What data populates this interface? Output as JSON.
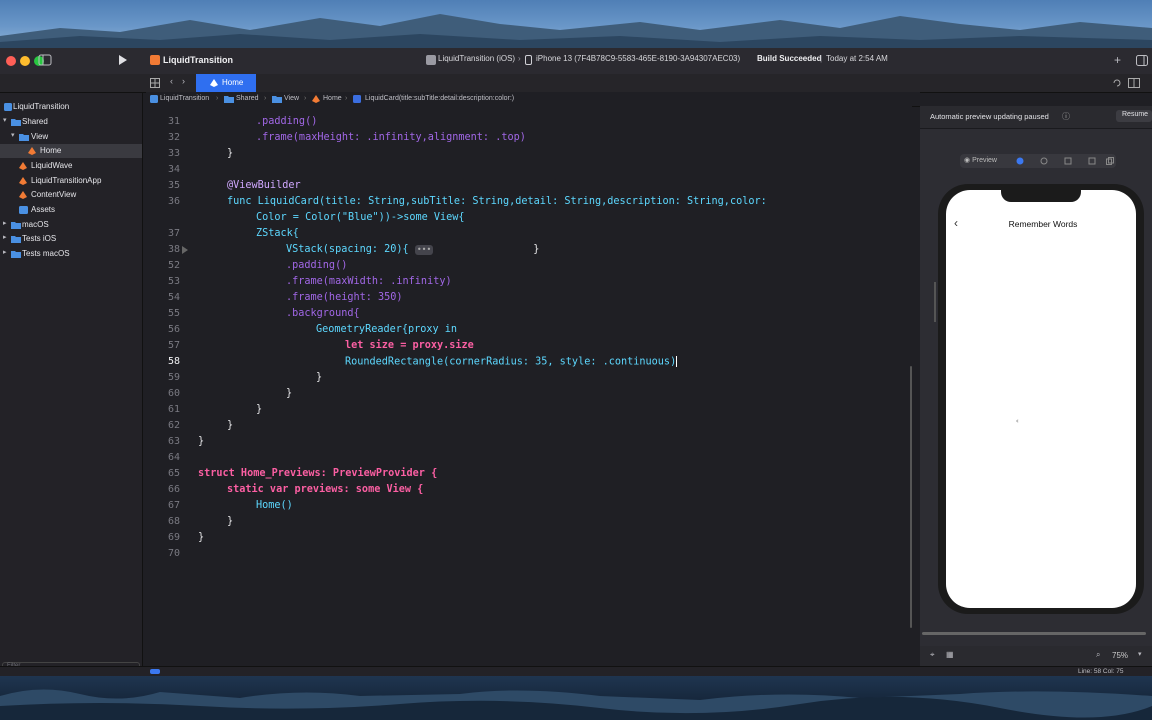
{
  "window": {
    "project_title": "LiquidTransition",
    "scheme": "LiquidTransition (iOS)",
    "device": "iPhone 13 (7F4B78C9-5583-465E-8190-3A94307AEC03)",
    "build_status": "Build Succeeded",
    "build_time": "Today at 2:54 AM"
  },
  "tabs": [
    {
      "label": "Home"
    }
  ],
  "breadcrumb": [
    "LiquidTransition",
    "Shared",
    "View",
    "Home",
    "LiquidCard(title:subTitle:detail:description:color:)"
  ],
  "sidebar": {
    "items": [
      {
        "label": "LiquidTransition",
        "indent": 0,
        "kind": "project"
      },
      {
        "label": "Shared",
        "indent": 1,
        "kind": "folder"
      },
      {
        "label": "View",
        "indent": 2,
        "kind": "folder"
      },
      {
        "label": "Home",
        "indent": 3,
        "kind": "swift",
        "selected": true
      },
      {
        "label": "LiquidWave",
        "indent": 2,
        "kind": "swift"
      },
      {
        "label": "LiquidTransitionApp",
        "indent": 2,
        "kind": "swift"
      },
      {
        "label": "ContentView",
        "indent": 2,
        "kind": "swift"
      },
      {
        "label": "Assets",
        "indent": 2,
        "kind": "assets"
      },
      {
        "label": "macOS",
        "indent": 1,
        "kind": "folder"
      },
      {
        "label": "Tests iOS",
        "indent": 1,
        "kind": "folder"
      },
      {
        "label": "Tests macOS",
        "indent": 1,
        "kind": "folder"
      }
    ],
    "filter_placeholder": "Filter"
  },
  "editor": {
    "current_line": "58",
    "line_numbers": [
      "31",
      "32",
      "33",
      "34",
      "35",
      "36",
      "",
      "37",
      "38",
      "52",
      "53",
      "54",
      "55",
      "56",
      "57",
      "58",
      "59",
      "60",
      "61",
      "62",
      "63",
      "64",
      "65",
      "66",
      "67",
      "68",
      "69",
      "70"
    ],
    "lines": [
      ".padding()",
      ".frame(maxHeight: .infinity,alignment: .top)",
      "}",
      "",
      "@ViewBuilder",
      "func LiquidCard(title: String,subTitle: String,detail: String,description: String,color:",
      "Color = Color(\"Blue\"))->some View{",
      "ZStack{",
      "VStack(spacing: 20){",
      ".padding()",
      ".frame(maxWidth: .infinity)",
      ".frame(height: 350)",
      ".background{",
      "GeometryReader{proxy in",
      "let size = proxy.size",
      "RoundedRectangle(cornerRadius: 35, style: .continuous)",
      "}",
      "}",
      "}",
      "}",
      "}",
      "",
      "struct Home_Previews: PreviewProvider {",
      "static var previews: some View {",
      "Home()",
      "}",
      "}",
      ""
    ],
    "fold_marker": "•••"
  },
  "preview": {
    "status": "Automatic preview updating paused",
    "resume_label": "Resume",
    "mode_label": "Preview",
    "screen_title": "Remember Words",
    "zoom": "75%"
  },
  "status": {
    "position": "Line: 58  Col: 75"
  }
}
